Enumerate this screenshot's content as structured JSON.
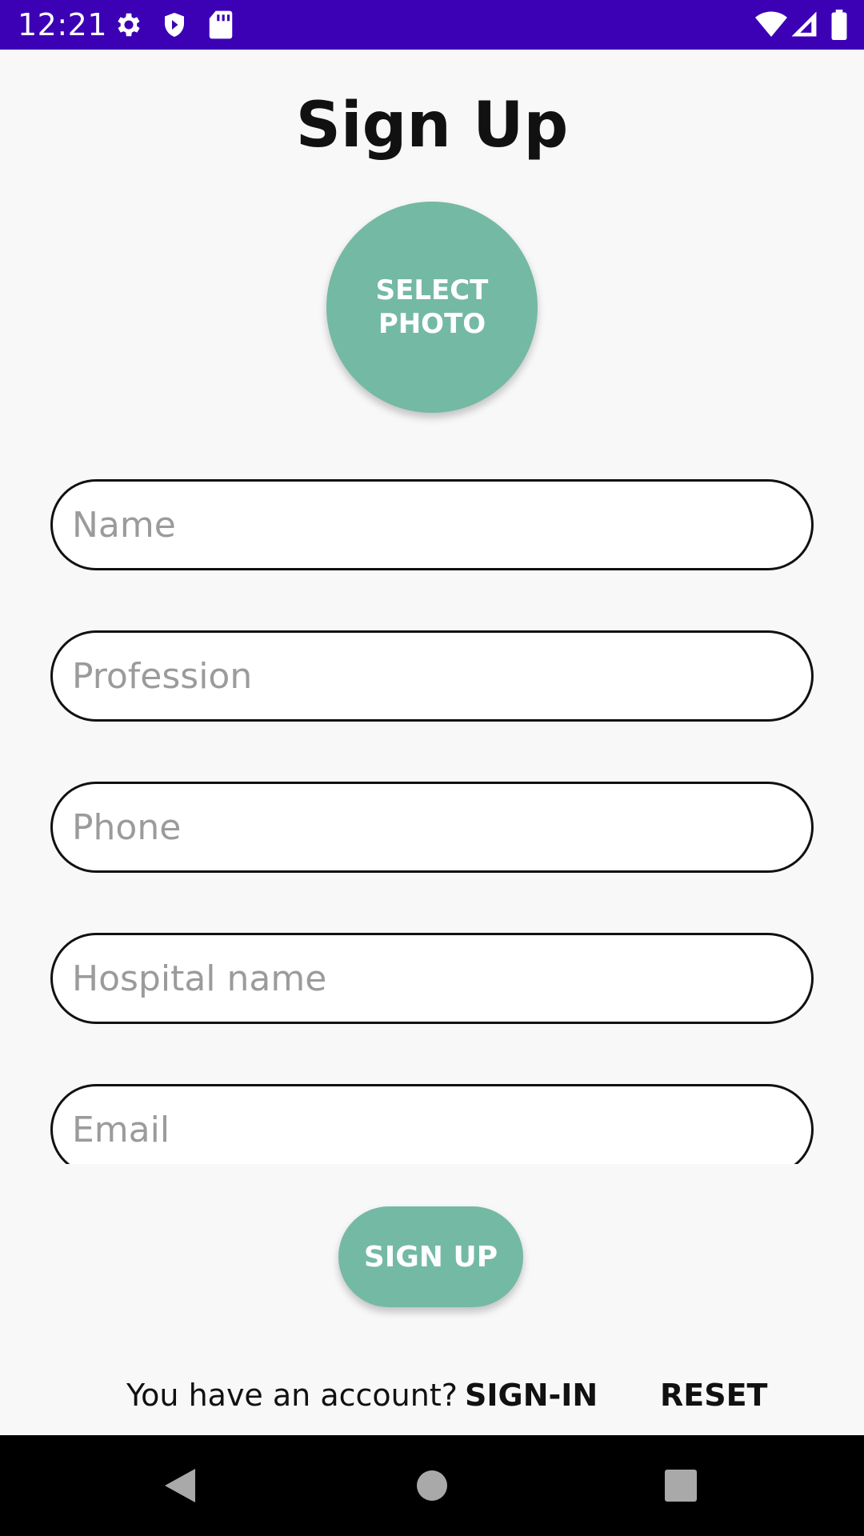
{
  "status_bar": {
    "time": "12:21",
    "icons": [
      "gear-icon",
      "shield-icon",
      "sd-card-icon",
      "wifi-icon",
      "cell-signal-icon",
      "battery-icon"
    ],
    "background": "#3c00b5"
  },
  "page": {
    "title": "Sign Up"
  },
  "photo": {
    "label": "SELECT PHOTO",
    "color": "#74b9a4"
  },
  "form": {
    "name_placeholder": "Name",
    "profession_placeholder": "Profession",
    "phone_placeholder": "Phone",
    "hospital_placeholder": "Hospital name",
    "email_placeholder": "Email"
  },
  "actions": {
    "signup_label": "SIGN UP",
    "account_prompt": "You have an account?",
    "signin_label": "SIGN-IN",
    "reset_label": "RESET"
  },
  "nav": {
    "icons": [
      "back-icon",
      "home-icon",
      "recents-icon"
    ]
  }
}
